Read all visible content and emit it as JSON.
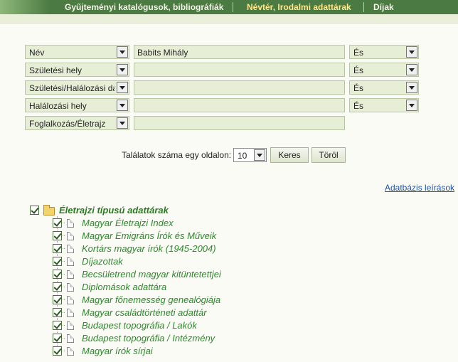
{
  "nav": {
    "tabs": [
      {
        "label": "Gyűjteményi katalógusok, bibliográfiák",
        "active": false
      },
      {
        "label": "Névtér, Irodalmi adattárak",
        "active": true
      },
      {
        "label": "Díjak",
        "active": false
      }
    ]
  },
  "search": {
    "rows": [
      {
        "field": "Név",
        "value": "Babits Mihály",
        "operator": "És"
      },
      {
        "field": "Születési hely",
        "value": "",
        "operator": "És"
      },
      {
        "field": "Születési/Halálozási dá",
        "value": "",
        "operator": "És"
      },
      {
        "field": "Halálozási hely",
        "value": "",
        "operator": "És"
      },
      {
        "field": "Foglalkozás/Életrajz",
        "value": ""
      }
    ],
    "per_page_label": "Találatok száma egy oldalon:",
    "per_page_value": "10",
    "search_button": "Keres",
    "clear_button": "Töröl"
  },
  "db_link": "Adatbázis leírások",
  "tree": {
    "root": {
      "label": "Életrajzi típusú adattárak",
      "checked": true
    },
    "items": [
      {
        "label": "Magyar Életrajzi Index",
        "checked": true
      },
      {
        "label": "Magyar Emigráns Írók és Műveik",
        "checked": true
      },
      {
        "label": "Kortárs magyar írók (1945-2004)",
        "checked": true
      },
      {
        "label": "Díjazottak",
        "checked": true
      },
      {
        "label": "Becsületrend magyar kitüntetettjei",
        "checked": true
      },
      {
        "label": "Diplomások adattára",
        "checked": true
      },
      {
        "label": "Magyar főnemesség genealógiája",
        "checked": true
      },
      {
        "label": "Magyar családtörténeti adattár",
        "checked": true
      },
      {
        "label": "Budapest topográfia / Lakók",
        "checked": true
      },
      {
        "label": "Budapest topográfia / Intézmény",
        "checked": true
      },
      {
        "label": "Magyar írók sírjai",
        "checked": true
      }
    ]
  }
}
